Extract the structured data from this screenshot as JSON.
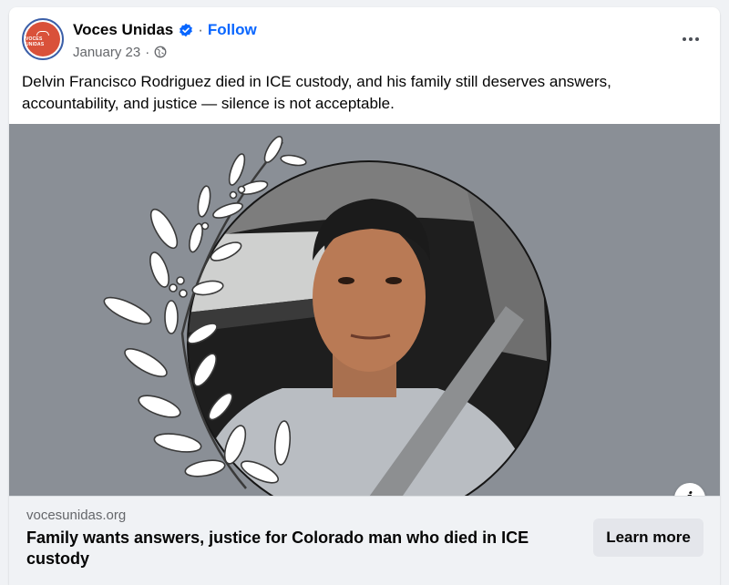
{
  "post": {
    "page_name": "Voces Unidas",
    "avatar_text": "VOCES UNIDAS",
    "follow_label": "Follow",
    "separator": "·",
    "date": "January 23",
    "audience_icon": "globe-icon",
    "verified_icon": "verified-badge-icon",
    "more_icon": "more-options-icon",
    "text": "Delvin Francisco Rodriguez died in ICE custody, and his family still deserves answers, accountability, and justice — silence is not acceptable."
  },
  "link_preview": {
    "domain": "vocesunidas.org",
    "headline": "Family wants answers, justice for Colorado man who died in ICE custody",
    "cta_label": "Learn more",
    "info_label": "i"
  },
  "colors": {
    "accent": "#0866ff",
    "avatar_bg": "#d9513a",
    "media_bg": "#8a8f96",
    "link_bar_bg": "#f0f2f5"
  }
}
